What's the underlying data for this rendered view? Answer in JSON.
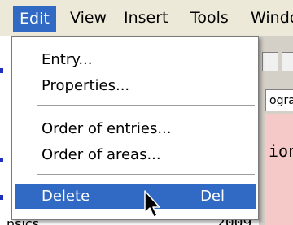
{
  "menubar": {
    "items": [
      {
        "label": "Edit"
      },
      {
        "label": "View"
      },
      {
        "label": "Insert"
      },
      {
        "label": "Tools"
      },
      {
        "label": "Windo"
      }
    ]
  },
  "edit_menu": {
    "items": [
      {
        "label": "Entry..."
      },
      {
        "label": "Properties..."
      },
      {
        "label": "Order of entries..."
      },
      {
        "label": "Order of areas..."
      },
      {
        "label": "Delete",
        "shortcut": "Del",
        "highlighted": true
      }
    ]
  },
  "background": {
    "tab_fragment": "ogra",
    "code_fragment": "ion",
    "bottom_left_fragment": "nsics",
    "bottom_right_fragment": "2009"
  },
  "colors": {
    "highlight": "#316ac5",
    "menubar": "#ece9d8",
    "pink_area": "#f6c9c9"
  },
  "cursor": {
    "icon": "arrow-cursor-icon"
  }
}
